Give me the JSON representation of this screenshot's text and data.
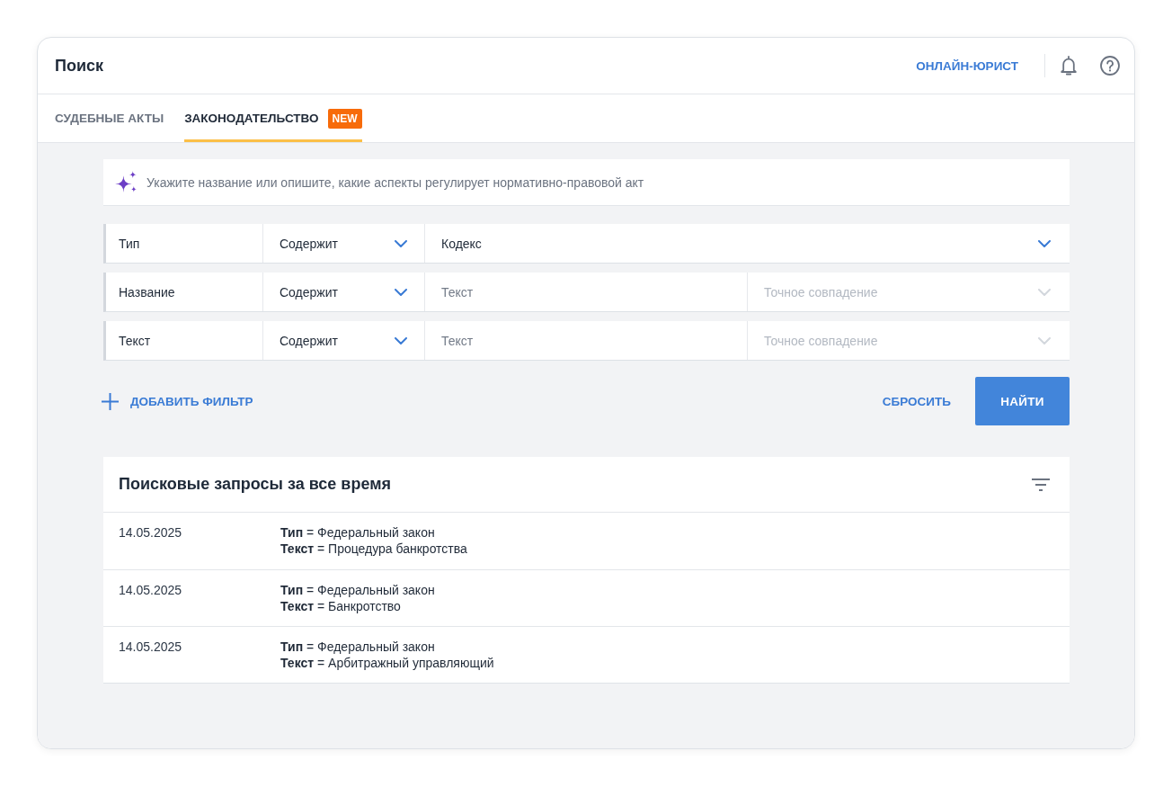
{
  "header": {
    "title": "Поиск",
    "link": "ОНЛАЙН-ЮРИСТ"
  },
  "tabs": [
    {
      "label": "СУДЕБНЫЕ АКТЫ",
      "selected": false
    },
    {
      "label": "ЗАКОНОДАТЕЛЬСТВО",
      "selected": true,
      "badge": "NEW"
    }
  ],
  "ai_search": {
    "placeholder": "Укажите название или опишите, какие аспекты регулирует нормативно-правовой акт"
  },
  "filters": [
    {
      "kind": "select",
      "field": "Тип",
      "operator": "Содержит",
      "value": "Кодекс"
    },
    {
      "kind": "text",
      "field": "Название",
      "operator": "Содержит",
      "placeholder": "Текст",
      "match": {
        "placeholder": "Точное совпадение",
        "disabled": true
      }
    },
    {
      "kind": "text",
      "field": "Текст",
      "operator": "Содержит",
      "placeholder": "Текст",
      "match": {
        "placeholder": "Точное совпадение",
        "disabled": true
      }
    }
  ],
  "actions": {
    "add_filter": "ДОБАВИТЬ ФИЛЬТР",
    "reset": "СБРОСИТЬ",
    "submit": "НАЙТИ"
  },
  "history": {
    "title": "Поисковые запросы за все время",
    "rows": [
      {
        "date": "14.05.2025",
        "conditions": [
          "**Тип** = Федеральный закон",
          "**Текст** = Процедура банкротства"
        ]
      },
      {
        "date": "14.05.2025",
        "conditions": [
          "**Тип** = Федеральный закон",
          "**Текст** = Банкротство"
        ]
      },
      {
        "date": "14.05.2025",
        "conditions": [
          "**Тип** = Федеральный закон",
          "**Текст** = Арбитражный управляющий"
        ]
      }
    ]
  }
}
